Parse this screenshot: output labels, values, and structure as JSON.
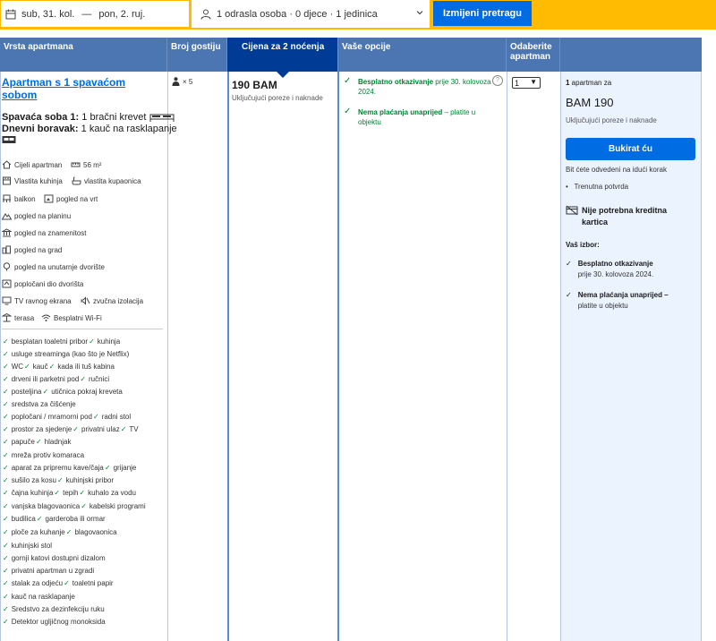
{
  "search": {
    "check_in": "sub, 31. kol.",
    "dash": "—",
    "check_out": "pon, 2. ruj.",
    "guests": "1 odrasla osoba · 0 djece · 1 jedinica",
    "change_button": "Izmijeni pretragu"
  },
  "headers": {
    "type": "Vrsta apartmana",
    "guests": "Broj gostiju",
    "price": "Cijena za 2 noćenja",
    "options": "Vaše opcije",
    "select": "Odaberite apartman"
  },
  "apartment": {
    "title": "Apartman s 1 spavaćom sobom",
    "bed1_label": "Spavaća soba 1:",
    "bed1_value": "1 bračni krevet",
    "bed2_label": "Dnevni boravak:",
    "bed2_value": "1 kauč na rasklapanje",
    "facilities": [
      "Cijeli apartman",
      "56 m²",
      "Vlastita kuhinja",
      "vlastita kupaonica",
      "balkon",
      "pogled na vrt",
      "pogled na planinu",
      "pogled na znamenitost",
      "pogled na grad",
      "pogled na unutarnje dvorište",
      "popločani dio dvorišta",
      "TV ravnog ekrana",
      "zvučna izolacija",
      "terasa",
      "Besplatni Wi-Fi"
    ],
    "amenities": [
      "besplatan toaletni pribor",
      "kuhinja",
      "usluge streaminga (kao što je Netflix)",
      "WC",
      "kauč",
      "kada ili tuš kabina",
      "drveni ili parketni pod",
      "ručnici",
      "posteljina",
      "utičnica pokraj kreveta",
      "sredstva za čišćenje",
      "popločani / mramorni pod",
      "radni stol",
      "prostor za sjedenje",
      "privatni ulaz",
      "TV",
      "papuče",
      "hladnjak",
      "mreža protiv komaraca",
      "aparat za pripremu kave/čaja",
      "grijanje",
      "sušilo za kosu",
      "kuhinjski pribor",
      "čajna kuhinja",
      "tepih",
      "kuhalo za vodu",
      "vanjska blagovaonica",
      "kabelski programi",
      "budilica",
      "garderoba ili ormar",
      "ploče za kuhanje",
      "blagovaonica",
      "kuhinjski stol",
      "gornji katovi dostupni dizalom",
      "privatni apartman u zgradi",
      "stalak za odjeću",
      "toaletni papir",
      "kauč na rasklapanje",
      "Sredstvo za dezinfekciju ruku",
      "Detektor ugljičnog monoksida"
    ]
  },
  "guests_count": "× 5",
  "price": {
    "amount": "190 BAM",
    "tax_note": "Uključujući poreze i naknade"
  },
  "options": {
    "cancel_bold": "Besplatno otkazivanje",
    "cancel_rest": " prije 30. kolovoza 2024.",
    "prepay_bold": "Nema plaćanja unaprijed",
    "prepay_rest": " – platite u objektu"
  },
  "select_value": "1",
  "summary": {
    "count_bold": "1",
    "count_rest": " apartman za",
    "price": "BAM 190",
    "tax_note": "Uključujući poreze i naknade",
    "book_button": "Bukirat ću",
    "next_step": "Bit ćete odvedeni na idući korak",
    "bullet": "Trenutna potvrda",
    "no_card": "Nije potrebna kreditna kartica",
    "choice_label": "Vaš izbor:",
    "choice1_bold": "Besplatno otkazivanje",
    "choice1_sub": "prije 30. kolovoza 2024.",
    "choice2_bold": "Nema plaćanja unaprijed –",
    "choice2_sub": "platite u objektu"
  },
  "colors": {
    "accent": "#006ce4",
    "header": "#4c76b2",
    "header_active": "#003b95",
    "yellow": "#febb02",
    "green": "#008234",
    "summary_bg": "#ebf3ff"
  }
}
